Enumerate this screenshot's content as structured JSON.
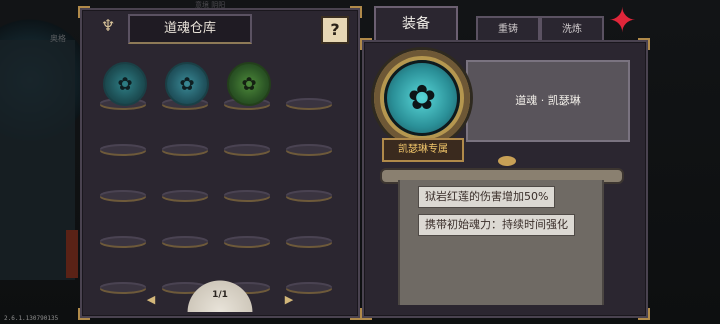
{
  "background": {
    "top_text": "意境 阴阳",
    "left_text": "奥格"
  },
  "version": "2.6.1.130790135",
  "left_panel": {
    "title": "道魂仓库",
    "help_label": "?",
    "slots": [
      {
        "state": "soul",
        "variant": "teal1",
        "icon": "character-soul-icon"
      },
      {
        "state": "soul",
        "variant": "teal2",
        "icon": "character-soul-icon"
      },
      {
        "state": "soul",
        "variant": "green",
        "icon": "character-soul-icon"
      },
      {
        "state": "empty"
      },
      {
        "state": "empty"
      },
      {
        "state": "empty"
      },
      {
        "state": "empty"
      },
      {
        "state": "empty"
      },
      {
        "state": "empty"
      },
      {
        "state": "empty"
      },
      {
        "state": "empty"
      },
      {
        "state": "empty"
      },
      {
        "state": "empty"
      },
      {
        "state": "empty"
      },
      {
        "state": "empty"
      },
      {
        "state": "empty"
      },
      {
        "state": "empty"
      },
      {
        "state": "empty"
      },
      {
        "state": "empty"
      },
      {
        "state": "empty"
      }
    ],
    "page": "1/1",
    "prev_icon": "arrow-left-icon",
    "next_icon": "arrow-right-icon"
  },
  "tabs": [
    {
      "label": "装备",
      "active": true
    },
    {
      "label": "重铸",
      "active": false
    },
    {
      "label": "洗炼",
      "active": false
    }
  ],
  "close_icon": "red-shuriken-close-icon",
  "detail": {
    "name": "道魂 · 凯瑟琳",
    "exclusive_label": "凯瑟琳专属",
    "effects": [
      "狱岩红莲的伤害增加50%",
      "携带初始魂力：持续时间强化"
    ]
  }
}
